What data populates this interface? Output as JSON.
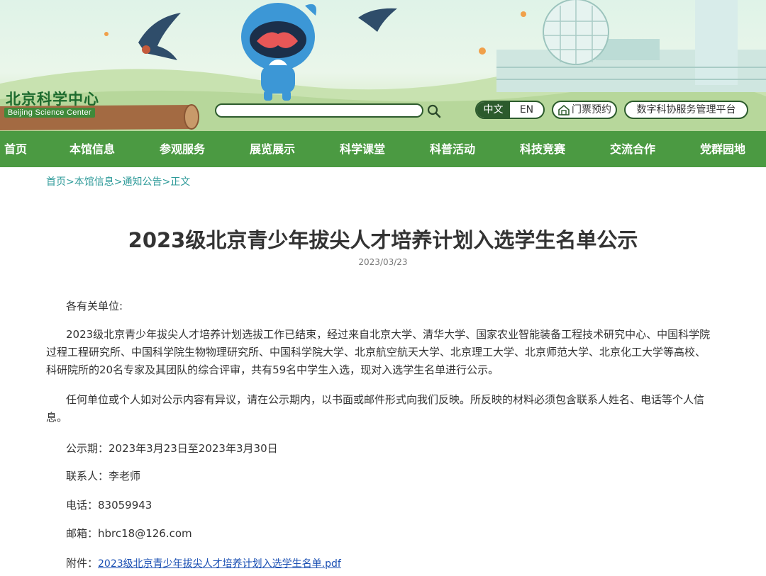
{
  "header": {
    "logo_cn": "北京科学中心",
    "logo_en": "Beijing Science Center",
    "search_placeholder": "",
    "lang_cn": "中文",
    "lang_en": "EN",
    "ticket_label": "门票预约",
    "platform_label": "数字科协服务管理平台"
  },
  "nav": [
    "首页",
    "本馆信息",
    "参观服务",
    "展览展示",
    "科学课堂",
    "科普活动",
    "科技竞赛",
    "交流合作",
    "党群园地"
  ],
  "breadcrumb": [
    "首页",
    "本馆信息",
    "通知公告",
    "正文"
  ],
  "breadcrumb_sep": ">",
  "article": {
    "title": "2023级北京青少年拔尖人才培养计划入选学生名单公示",
    "date": "2023/03/23",
    "greeting": "各有关单位:",
    "para1": "2023级北京青少年拔尖人才培养计划选拔工作已结束，经过来自北京大学、清华大学、国家农业智能装备工程技术研究中心、中国科学院过程工程研究所、中国科学院生物物理研究所、中国科学院大学、北京航空航天大学、北京理工大学、北京师范大学、北京化工大学等高校、科研院所的20名专家及其团队的综合评审，共有59名中学生入选，现对入选学生名单进行公示。",
    "para2": "任何单位或个人如对公示内容有异议，请在公示期内，以书面或邮件形式向我们反映。所反映的材料必须包含联系人姓名、电话等个人信息。",
    "period": "公示期：2023年3月23日至2023年3月30日",
    "contact": "联系人：李老师",
    "phone": "电话：83059943",
    "email": "邮箱：hbrc18@126.com",
    "attachment_label": "附件：",
    "attachment_link": "2023级北京青少年拔尖人才培养计划入选学生名单.pdf"
  },
  "colors": {
    "nav_bg": "#4b9a42",
    "breadcrumb": "#2f9b9a",
    "link": "#1a4fb3",
    "header_dark_green": "#2c5b2c"
  }
}
